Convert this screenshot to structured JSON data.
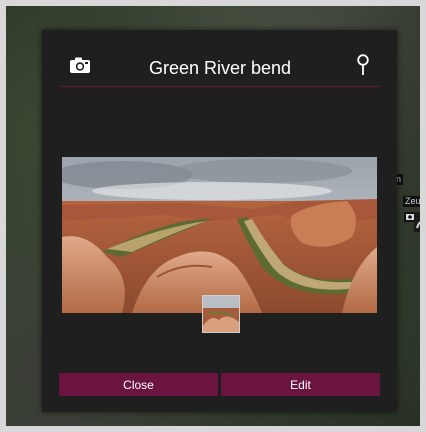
{
  "dialog": {
    "title": "Green River bend",
    "camera_icon": "camera-icon",
    "pin_icon": "location-pin-icon",
    "accent_color": "#6b1440",
    "background_color": "#1f1f1f"
  },
  "buttons": {
    "close_label": "Close",
    "edit_label": "Edit"
  },
  "map": {
    "chip_top": "n",
    "chip_mid": "Zeu"
  }
}
